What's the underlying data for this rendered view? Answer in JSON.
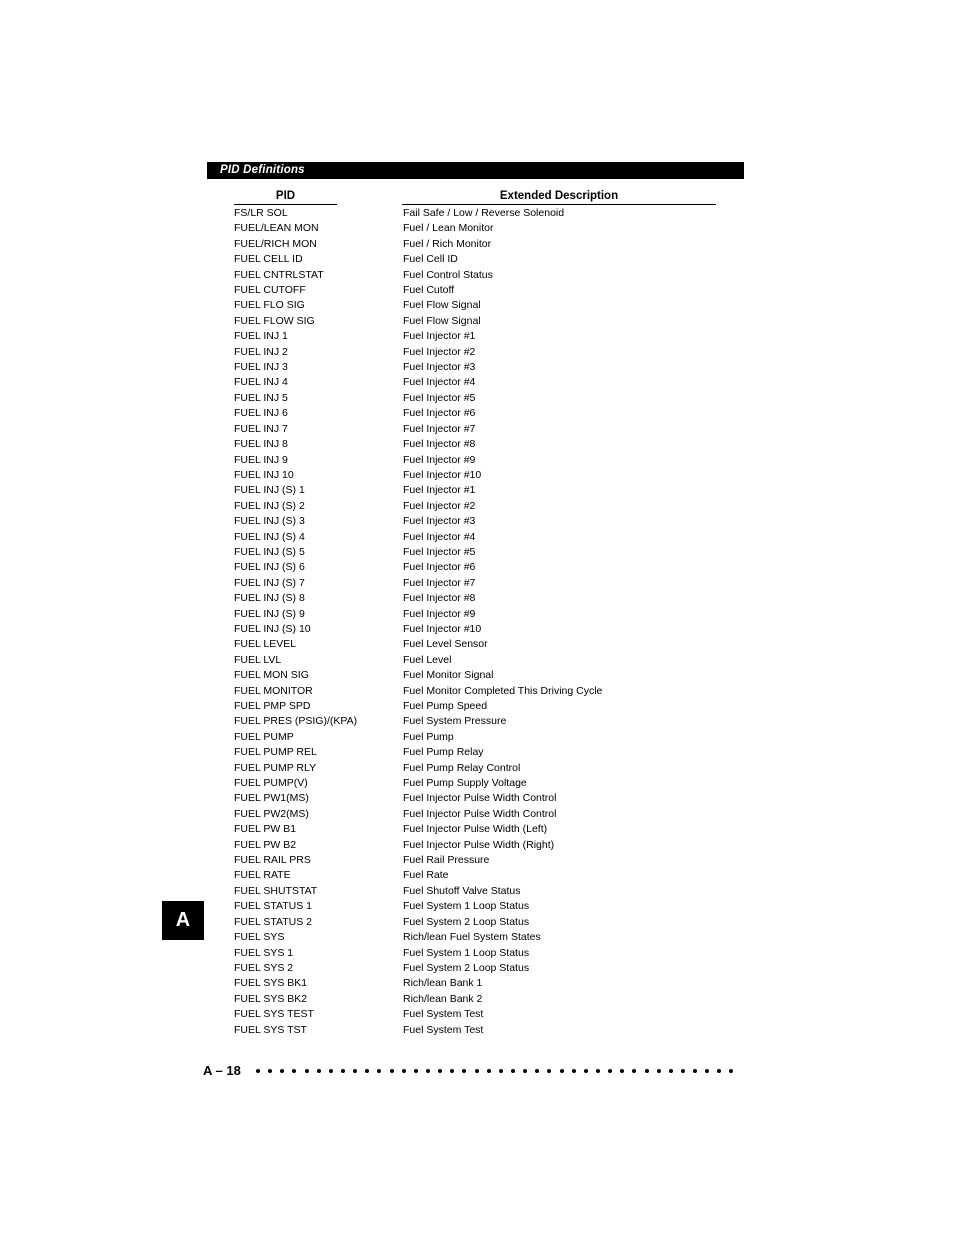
{
  "section": {
    "title": "PID Definitions"
  },
  "columns": {
    "pid": "PID",
    "description": "Extended Description"
  },
  "rows": [
    {
      "pid": "FS/LR SOL",
      "description": "Fail Safe / Low / Reverse Solenoid"
    },
    {
      "pid": "FUEL/LEAN MON",
      "description": "Fuel / Lean Monitor"
    },
    {
      "pid": "FUEL/RICH MON",
      "description": "Fuel / Rich Monitor"
    },
    {
      "pid": "FUEL CELL ID",
      "description": "Fuel Cell ID"
    },
    {
      "pid": "FUEL CNTRLSTAT",
      "description": "Fuel Control Status"
    },
    {
      "pid": "FUEL CUTOFF",
      "description": "Fuel Cutoff"
    },
    {
      "pid": "FUEL FLO SIG",
      "description": "Fuel Flow Signal"
    },
    {
      "pid": "FUEL FLOW SIG",
      "description": "Fuel Flow Signal"
    },
    {
      "pid": "FUEL INJ 1",
      "description": "Fuel Injector #1"
    },
    {
      "pid": "FUEL INJ 2",
      "description": "Fuel Injector #2"
    },
    {
      "pid": "FUEL INJ 3",
      "description": "Fuel Injector #3"
    },
    {
      "pid": "FUEL INJ 4",
      "description": "Fuel Injector #4"
    },
    {
      "pid": "FUEL INJ 5",
      "description": "Fuel Injector #5"
    },
    {
      "pid": "FUEL INJ 6",
      "description": "Fuel Injector #6"
    },
    {
      "pid": "FUEL INJ 7",
      "description": "Fuel Injector #7"
    },
    {
      "pid": "FUEL INJ 8",
      "description": "Fuel Injector #8"
    },
    {
      "pid": "FUEL INJ 9",
      "description": "Fuel Injector #9"
    },
    {
      "pid": "FUEL INJ 10",
      "description": "Fuel Injector #10"
    },
    {
      "pid": "FUEL INJ (S) 1",
      "description": "Fuel Injector #1"
    },
    {
      "pid": "FUEL INJ (S) 2",
      "description": "Fuel Injector #2"
    },
    {
      "pid": "FUEL INJ (S) 3",
      "description": "Fuel Injector #3"
    },
    {
      "pid": "FUEL INJ (S) 4",
      "description": "Fuel Injector #4"
    },
    {
      "pid": "FUEL INJ (S) 5",
      "description": "Fuel Injector #5"
    },
    {
      "pid": "FUEL INJ (S) 6",
      "description": "Fuel Injector #6"
    },
    {
      "pid": "FUEL INJ (S) 7",
      "description": "Fuel Injector #7"
    },
    {
      "pid": "FUEL INJ (S) 8",
      "description": "Fuel Injector #8"
    },
    {
      "pid": "FUEL INJ (S) 9",
      "description": "Fuel Injector #9"
    },
    {
      "pid": "FUEL INJ (S) 10",
      "description": "Fuel Injector #10"
    },
    {
      "pid": "FUEL LEVEL",
      "description": "Fuel Level Sensor"
    },
    {
      "pid": "FUEL LVL",
      "description": "Fuel Level"
    },
    {
      "pid": "FUEL MON SIG",
      "description": "Fuel Monitor Signal"
    },
    {
      "pid": "FUEL MONITOR",
      "description": "Fuel Monitor Completed This Driving Cycle"
    },
    {
      "pid": "FUEL PMP SPD",
      "description": "Fuel Pump Speed"
    },
    {
      "pid": "FUEL PRES (PSIG)/(KPA)",
      "description": "Fuel System Pressure"
    },
    {
      "pid": "FUEL PUMP",
      "description": "Fuel Pump"
    },
    {
      "pid": "FUEL PUMP REL",
      "description": "Fuel Pump Relay"
    },
    {
      "pid": "FUEL PUMP RLY",
      "description": "Fuel Pump Relay Control"
    },
    {
      "pid": "FUEL PUMP(V)",
      "description": "Fuel Pump Supply Voltage"
    },
    {
      "pid": "FUEL PW1(MS)",
      "description": "Fuel Injector Pulse Width Control"
    },
    {
      "pid": "FUEL PW2(MS)",
      "description": "Fuel Injector Pulse Width Control"
    },
    {
      "pid": "FUEL PW B1",
      "description": "Fuel Injector Pulse Width (Left)"
    },
    {
      "pid": "FUEL PW B2",
      "description": "Fuel Injector Pulse Width (Right)"
    },
    {
      "pid": "FUEL RAIL PRS",
      "description": "Fuel Rail Pressure"
    },
    {
      "pid": "FUEL RATE",
      "description": "Fuel Rate"
    },
    {
      "pid": "FUEL SHUTSTAT",
      "description": "Fuel Shutoff Valve Status"
    },
    {
      "pid": "FUEL STATUS 1",
      "description": "Fuel System 1 Loop Status"
    },
    {
      "pid": "FUEL STATUS 2",
      "description": "Fuel System 2 Loop Status"
    },
    {
      "pid": "FUEL SYS",
      "description": "Rich/lean Fuel System States"
    },
    {
      "pid": "FUEL SYS 1",
      "description": "Fuel System 1 Loop Status"
    },
    {
      "pid": "FUEL SYS 2",
      "description": "Fuel System 2 Loop Status"
    },
    {
      "pid": "FUEL SYS BK1",
      "description": "Rich/lean Bank 1"
    },
    {
      "pid": "FUEL SYS BK2",
      "description": "Rich/lean Bank 2"
    },
    {
      "pid": "FUEL SYS TEST",
      "description": "Fuel System Test"
    },
    {
      "pid": "FUEL SYS TST",
      "description": "Fuel System Test"
    }
  ],
  "side_tab": {
    "letter": "A"
  },
  "footer": {
    "page_number": "A – 18",
    "dot_count": 47
  },
  "colors": {
    "header_bar_background": "#000000",
    "header_bar_text": "#ffffff",
    "body_text": "#000000",
    "page_background": "#ffffff"
  }
}
